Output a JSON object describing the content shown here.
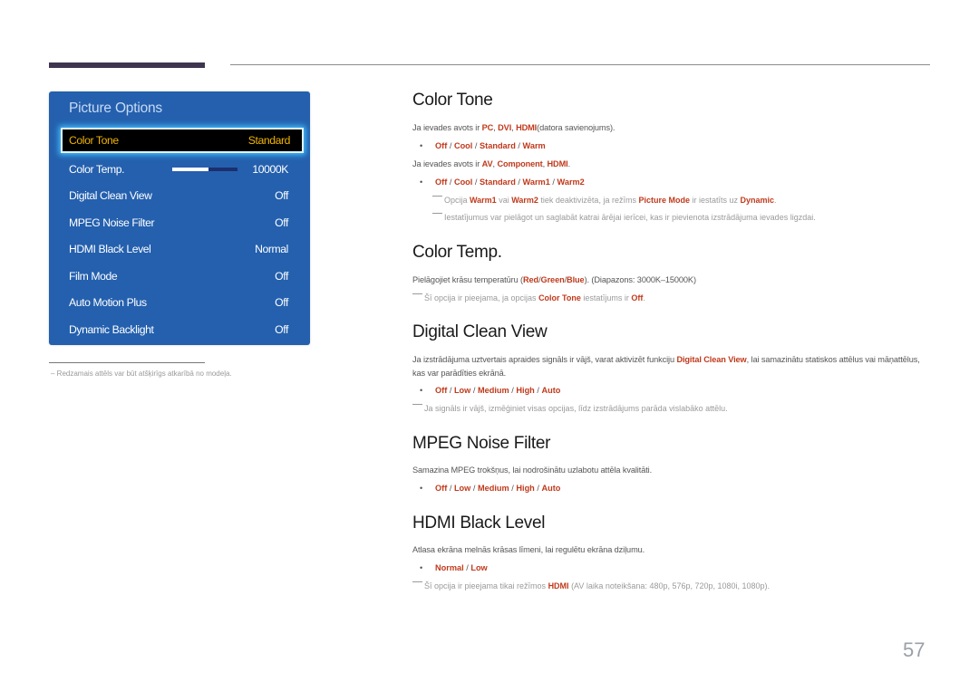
{
  "osd": {
    "title": "Picture Options",
    "selected": {
      "label": "Color Tone",
      "value": "Standard"
    },
    "items": [
      {
        "label": "Color Temp.",
        "value": "10000K",
        "slider_fraction": 0.55
      },
      {
        "label": "Digital Clean View",
        "value": "Off"
      },
      {
        "label": "MPEG Noise Filter",
        "value": "Off"
      },
      {
        "label": "HDMI Black Level",
        "value": "Normal"
      },
      {
        "label": "Film Mode",
        "value": "Off"
      },
      {
        "label": "Auto Motion Plus",
        "value": "Off"
      },
      {
        "label": "Dynamic Backlight",
        "value": "Off"
      }
    ],
    "footnote": "–  Redzamais attēls var būt atšķirīgs atkarībā no modeļa."
  },
  "sections": {
    "color_tone": {
      "heading": "Color Tone",
      "line1": {
        "pre": "Ja ievades avots ir ",
        "hl1": "PC",
        "s1": ", ",
        "hl2": "DVI",
        "s2": ", ",
        "hl3": "HDMI",
        "post": "(datora savienojums)."
      },
      "bullet1": [
        "Off",
        "Cool",
        "Standard",
        "Warm"
      ],
      "line2": {
        "pre": "Ja ievades avots ir ",
        "hl1": "AV",
        "s1": ", ",
        "hl2": "Component",
        "s2": ", ",
        "hl3": "HDMI",
        "post": "."
      },
      "bullet2": [
        "Off",
        "Cool",
        "Standard",
        "Warm1",
        "Warm2"
      ],
      "note1": {
        "t1": "Opcija ",
        "h1": "Warm1",
        "t2": " vai ",
        "h2": "Warm2",
        "t3": " tiek deaktivizēta, ja režīms ",
        "h3": "Picture Mode",
        "t4": " ir iestatīts uz ",
        "h4": "Dynamic",
        "t5": "."
      },
      "note2": "Iestatījumus var pielāgot un saglabāt katrai ārējai ierīcei, kas ir pievienota izstrādājuma ievades ligzdai."
    },
    "color_temp": {
      "heading": "Color Temp.",
      "line": {
        "t1": "Pielāgojiet krāsu temperatūru (",
        "h1": "Red",
        "s1": "/",
        "h2": "Green",
        "s2": "/",
        "h3": "Blue",
        "t2": "). (Diapazons: 3000K–15000K)"
      },
      "note": {
        "t1": "Šī opcija ir pieejama, ja opcijas ",
        "h1": "Color Tone",
        "t2": " iestatījums ir ",
        "h2": "Off",
        "t3": "."
      }
    },
    "digital_clean_view": {
      "heading": "Digital Clean View",
      "line": {
        "t1": "Ja izstrādājuma uztvertais apraides signāls ir vājš, varat aktivizēt funkciju ",
        "h1": "Digital Clean View",
        "t2": ", lai samazinātu statiskos attēlus vai māņattēlus, kas var parādīties ekrānā."
      },
      "bullet": [
        "Off",
        "Low",
        "Medium",
        "High",
        "Auto"
      ],
      "note": "Ja signāls ir vājš, izmēģiniet visas opcijas, līdz izstrādājums parāda vislabāko attēlu."
    },
    "mpeg_noise_filter": {
      "heading": "MPEG Noise Filter",
      "line": "Samazina MPEG trokšņus, lai nodrošinātu uzlabotu attēla kvalitāti.",
      "bullet": [
        "Off",
        "Low",
        "Medium",
        "High",
        "Auto"
      ]
    },
    "hdmi_black_level": {
      "heading": "HDMI Black Level",
      "line": "Atlasa ekrāna melnās krāsas līmeni, lai regulētu ekrāna dziļumu.",
      "bullet": [
        "Normal",
        "Low"
      ],
      "note": {
        "t1": "Šī opcija ir pieejama tikai režīmos ",
        "h1": "HDMI",
        "t2": " (AV laika noteikšana: 480p, 576p, 720p, 1080i, 1080p)."
      }
    }
  },
  "page_number": "57",
  "colors": {
    "accent": "#c0391b",
    "osd_bg": "#2460ae",
    "osd_selected_text": "#f0b400"
  }
}
